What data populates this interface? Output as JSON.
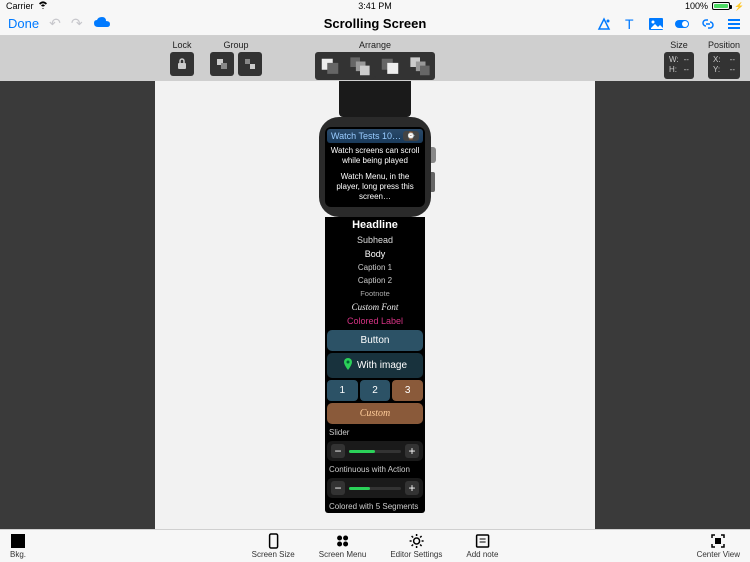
{
  "status": {
    "carrier": "Carrier",
    "time": "3:41 PM",
    "battery": "100%"
  },
  "nav": {
    "done": "Done",
    "title": "Scrolling Screen"
  },
  "toolbar": {
    "lock": "Lock",
    "group": "Group",
    "arrange": "Arrange",
    "size": "Size",
    "position": "Position",
    "w_label": "W:",
    "h_label": "H:",
    "x_label": "X:",
    "y_label": "Y:",
    "dash": "--"
  },
  "watch": {
    "header": "Watch Tests 10…",
    "intro1": "Watch screens can scroll while being played",
    "intro2": "Watch Menu, in the player, long press this screen…",
    "headline": "Headline",
    "subhead": "Subhead",
    "body": "Body",
    "caption1": "Caption 1",
    "caption2": "Caption 2",
    "footnote": "Footnote",
    "custom_font": "Custom Font",
    "colored_label": "Colored Label",
    "button": "Button",
    "with_image": "With image",
    "seg1": "1",
    "seg2": "2",
    "seg3": "3",
    "custom_btn": "Custom",
    "slider_label": "Slider",
    "slider2_label": "Continuous with Action",
    "slider3_label": "Colored with 5 Segments"
  },
  "bottom": {
    "bkg": "Bkg.",
    "screen_size": "Screen Size",
    "screen_menu": "Screen Menu",
    "editor_settings": "Editor Settings",
    "add_note": "Add note",
    "center_view": "Center View"
  }
}
